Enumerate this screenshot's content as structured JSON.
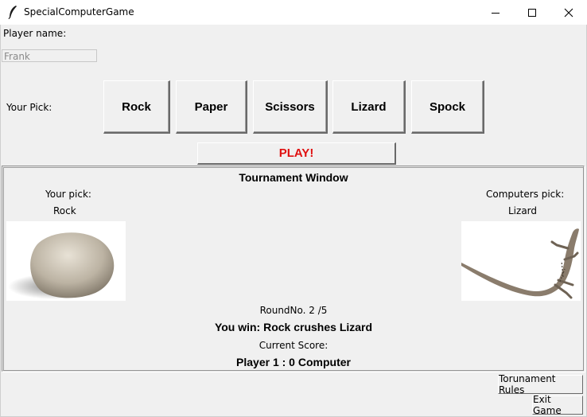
{
  "window": {
    "title": "SpecialComputerGame",
    "app_icon": "feather-icon",
    "controls": [
      "minimize-icon",
      "maximize-icon",
      "close-icon"
    ]
  },
  "player": {
    "name_label": "Player name:",
    "name_value": "Frank"
  },
  "picks": {
    "label": "Your Pick:",
    "options": [
      "Rock",
      "Paper",
      "Scissors",
      "Lizard",
      "Spock"
    ]
  },
  "play_button": {
    "label": "PLAY!",
    "color": "#e01010"
  },
  "tournament": {
    "title": "Tournament Window",
    "your_pick_label": "Your pick:",
    "your_pick_value": "Rock",
    "computer_pick_label": "Computers pick:",
    "computer_pick_value": "Lizard",
    "round": "RoundNo. 2 /5",
    "result": "You win: Rock crushes Lizard",
    "score_label": "Current Score:",
    "score": "Player 1 : 0 Computer"
  },
  "footer": {
    "rules_button": "Torunament Rules",
    "exit_button": "Exit Game"
  }
}
